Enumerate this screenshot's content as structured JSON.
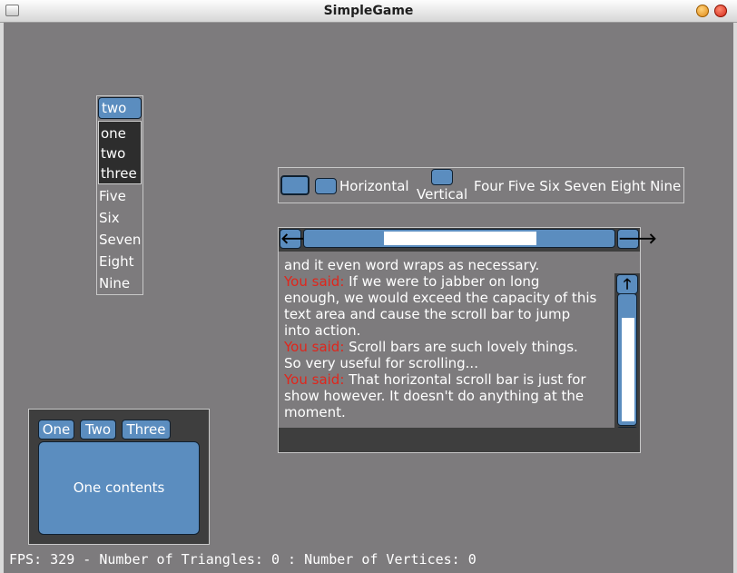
{
  "window": {
    "title": "SimpleGame"
  },
  "list_panel": {
    "combo_value": "two",
    "dropdown_options": [
      "one",
      "two",
      "three"
    ],
    "items": [
      "Five",
      "Six",
      "Seven",
      "Eight",
      "Nine"
    ]
  },
  "button_bar": {
    "horizontal_label": "Horizontal",
    "vertical_label": "Vertical",
    "trailing_text": "Four Five Six Seven Eight Nine"
  },
  "text_area": {
    "lines": [
      {
        "prefix": "",
        "text": "and it even word wraps as necessary."
      },
      {
        "prefix": "You said:",
        "text": " If we were to jabber on long"
      },
      {
        "prefix": "",
        "text": "enough, we would exceed the capacity of this"
      },
      {
        "prefix": "",
        "text": "text area and cause the scroll bar to jump"
      },
      {
        "prefix": "",
        "text": "into action."
      },
      {
        "prefix": "You said:",
        "text": " Scroll bars are such lovely things."
      },
      {
        "prefix": "",
        "text": "So very useful for scrolling..."
      },
      {
        "prefix": "You said:",
        "text": " That horizontal scroll bar is just for"
      },
      {
        "prefix": "",
        "text": "show however. It doesn't do anything at the"
      },
      {
        "prefix": "",
        "text": "moment."
      }
    ],
    "left_arrow": "🡐",
    "right_arrow": "🡒",
    "up_arrow": "🡑",
    "down_arrow": "🡓"
  },
  "tabs": {
    "labels": [
      "One",
      "Two",
      "Three"
    ],
    "content": "One contents"
  },
  "status": {
    "fps_text": "FPS: 329 - Number of Triangles: 0 : Number of Vertices: 0"
  },
  "colors": {
    "background": "#7d7b7d",
    "widget_blue": "#5b8dbf",
    "dark_panel": "#3e3e3e",
    "speaker_red": "#e0261c"
  }
}
